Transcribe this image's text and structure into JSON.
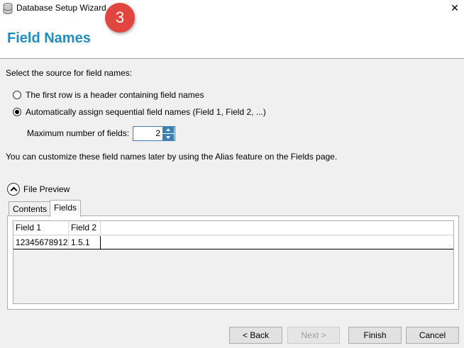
{
  "window": {
    "title": "Database Setup Wizard",
    "step_number": "3",
    "close_glyph": "✕"
  },
  "page": {
    "title": "Field Names"
  },
  "source": {
    "prompt": "Select the source for field names:",
    "options": [
      {
        "label": "The first row is a header containing field names",
        "selected": false
      },
      {
        "label": "Automatically assign sequential field names (Field 1, Field 2, ...)",
        "selected": true
      }
    ]
  },
  "max_fields": {
    "label": "Maximum number of fields:",
    "value": "2"
  },
  "note": "You can customize these field names later by using the Alias feature on the Fields page.",
  "preview": {
    "toggle_label": "File Preview",
    "tabs": [
      {
        "label": "Contents",
        "active": false
      },
      {
        "label": "Fields",
        "active": true
      }
    ],
    "columns": [
      "Field 1",
      "Field 2"
    ],
    "rows": [
      [
        "12345678912",
        "1.5.1"
      ]
    ]
  },
  "buttons": {
    "back": "< Back",
    "next": "Next >",
    "finish": "Finish",
    "cancel": "Cancel"
  },
  "colors": {
    "title_blue": "#1d8ec4",
    "step_badge_red": "#e0463f",
    "spinner_blue": "#3c7fb1"
  },
  "icons": {
    "app": "database-icon",
    "close": "close-icon",
    "collapse": "chevron-up-circle-icon"
  }
}
